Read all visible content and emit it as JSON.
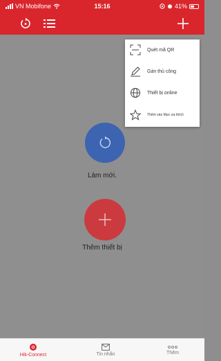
{
  "status_bar": {
    "carrier": "VN Mobifone",
    "time": "15:16",
    "battery": "41%"
  },
  "top_bar": {
    "icons": [
      "refresh-icon",
      "list-icon",
      "plus-icon"
    ]
  },
  "dropdown_menu": {
    "items": [
      {
        "label": "Quét mã QR",
        "icon": "qr-scan-icon"
      },
      {
        "label": "Gán thủ công",
        "icon": "pencil-icon"
      },
      {
        "label": "Thiết bị online",
        "icon": "globe-icon"
      },
      {
        "label": "Thêm vào Mục ưa thích",
        "icon": "star-icon"
      }
    ]
  },
  "main": {
    "refresh_label": "Làm mới.",
    "add_device_label": "Thêm thiết bị"
  },
  "tabs": [
    {
      "label": "Hik-Connect",
      "icon": "hik-connect-icon",
      "active": true
    },
    {
      "label": "Tin nhắn",
      "icon": "message-icon",
      "active": false
    },
    {
      "label": "Thêm",
      "icon": "more-icon",
      "active": false
    }
  ],
  "colors": {
    "brand_red": "#d9262c",
    "refresh_blue": "#3c64b0",
    "add_red": "#cb3a3e",
    "overlay_gray": "#8f8f8f",
    "active_tab": "#d9262c",
    "inactive_tab": "#777777"
  }
}
